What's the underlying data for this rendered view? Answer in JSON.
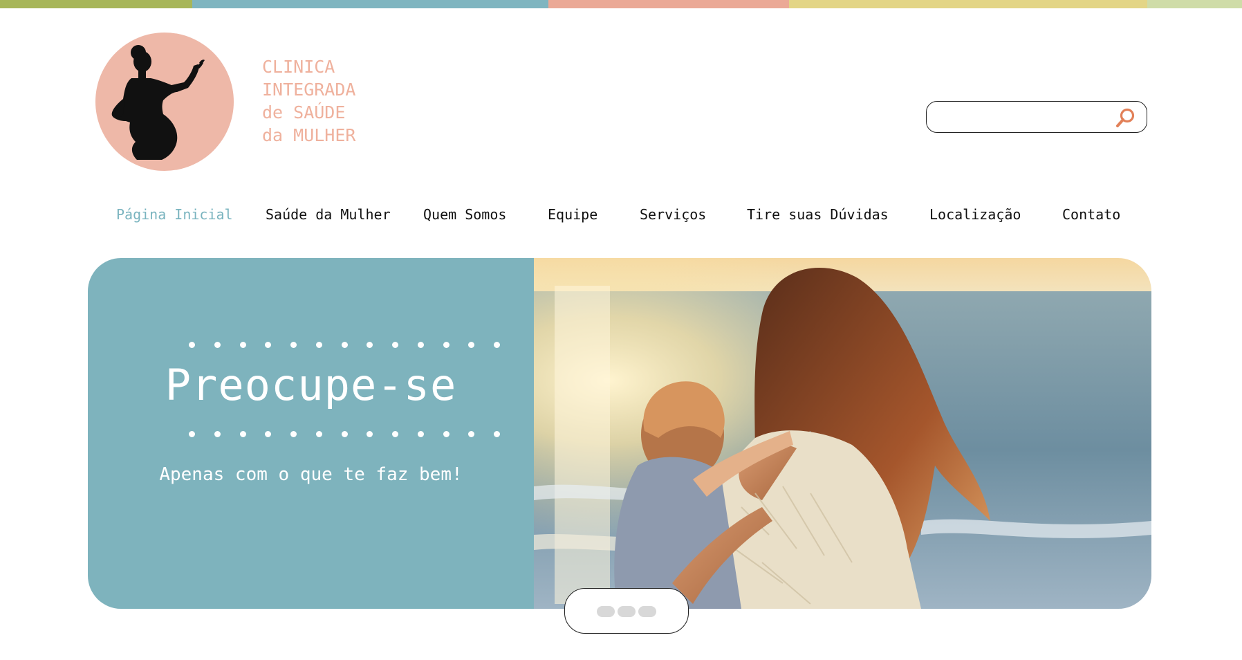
{
  "colors": {
    "top_stripes": [
      "#a7b659",
      "#7fb5c0",
      "#7fb5c0",
      "#eba996",
      "#e3d586",
      "#cfdca8"
    ],
    "brand": "#efb19d",
    "nav_active": "#7ab4bf",
    "hero_panel": "#7eb3bd",
    "logo_circle": "#eeb8a8",
    "search_icon": "#e28058"
  },
  "logo": {
    "icon": "pregnant-woman-silhouette-icon"
  },
  "brand": {
    "lines": [
      "CLINICA",
      "INTEGRADA",
      "de SAÚDE",
      "da MULHER"
    ]
  },
  "search": {
    "value": "",
    "placeholder": "",
    "icon": "search-icon"
  },
  "nav": {
    "items": [
      {
        "label": "Página Inicial",
        "active": true
      },
      {
        "label": "Saúde da Mulher",
        "active": false
      },
      {
        "label": "Quem Somos",
        "active": false
      },
      {
        "label": "Equipe",
        "active": false
      },
      {
        "label": "Serviços",
        "active": false
      },
      {
        "label": "Tire suas Dúvidas",
        "active": false
      },
      {
        "label": "Localização",
        "active": false
      },
      {
        "label": "Contato",
        "active": false
      }
    ]
  },
  "hero": {
    "title": "Preocupe-se",
    "subtitle": "Apenas com o que te faz bem!",
    "image": "mother-and-child-at-beach-sunset-photo"
  },
  "carousel": {
    "dots": 3
  }
}
